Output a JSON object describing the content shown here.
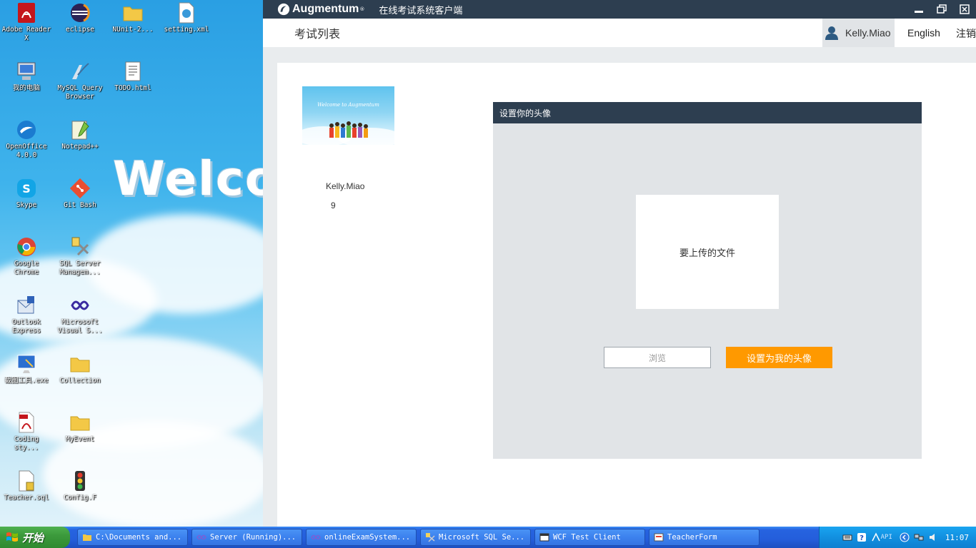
{
  "desktop": {
    "wallpaper_text": "Welco",
    "icons": [
      {
        "label": "Adobe Reader X",
        "icon": "pdf-icon"
      },
      {
        "label": "eclipse",
        "icon": "eclipse-icon"
      },
      {
        "label": "NUnit-2...",
        "icon": "folder-icon"
      },
      {
        "label": "setting.xml",
        "icon": "xml-file-icon"
      },
      {
        "label": "我的电脑",
        "icon": "my-computer-icon"
      },
      {
        "label": "MySQL Query Browser",
        "icon": "mysql-icon"
      },
      {
        "label": "TODO.html",
        "icon": "html-file-icon"
      },
      {
        "label": "OpenOffice 4.0.0",
        "icon": "openoffice-icon"
      },
      {
        "label": "Notepad++",
        "icon": "notepad-icon"
      },
      {
        "label": "Skype",
        "icon": "skype-icon"
      },
      {
        "label": "Git Bash",
        "icon": "git-icon"
      },
      {
        "label": "Google Chrome",
        "icon": "chrome-icon"
      },
      {
        "label": "SQL Server Managem...",
        "icon": "sql-server-icon"
      },
      {
        "label": "Outlook Express",
        "icon": "outlook-icon"
      },
      {
        "label": "Microsoft Visual S...",
        "icon": "visual-studio-icon"
      },
      {
        "label": "截图工具.exe",
        "icon": "screenshot-tool-icon"
      },
      {
        "label": "Collection",
        "icon": "folder-icon"
      },
      {
        "label": "Coding sty...",
        "icon": "pdf-icon"
      },
      {
        "label": "MyEvent",
        "icon": "folder-icon"
      },
      {
        "label": "Teacher.sql",
        "icon": "sql-file-icon"
      },
      {
        "label": "Config.F",
        "icon": "traffic-light-icon"
      }
    ]
  },
  "app": {
    "brand": "Augmentum",
    "brand_tm": "®",
    "title": "在线考试系统客户端",
    "nav_title": "考试列表",
    "user_name": "Kelly.Miao",
    "language": "English",
    "logout": "注销",
    "profile": {
      "picture_text": "Welcome to Augmentum",
      "name": "Kelly.Miao",
      "count": "9"
    },
    "avatar_dialog": {
      "title": "设置你的头像",
      "upload_placeholder": "要上传的文件",
      "browse_label": "浏览",
      "set_button": "设置为我的头像"
    }
  },
  "taskbar": {
    "start_label": "开始",
    "tasks": [
      {
        "label": "C:\\Documents and...",
        "icon": "folder-icon"
      },
      {
        "label": "Server (Running)...",
        "icon": "visual-studio-icon"
      },
      {
        "label": "onlineExamSystem...",
        "icon": "visual-studio-icon"
      },
      {
        "label": "Microsoft SQL Se...",
        "icon": "sql-server-icon"
      },
      {
        "label": "WCF Test Client",
        "icon": "window-icon"
      },
      {
        "label": "TeacherForm",
        "icon": "form-icon"
      }
    ],
    "tray_api": "API",
    "clock": "11:07"
  },
  "colors": {
    "header_dark": "#2d3e50",
    "accent_orange": "#ff9900",
    "panel_gray": "#e1e4e7",
    "taskbar_blue": "#245edb",
    "start_green": "#3c9a3c"
  }
}
